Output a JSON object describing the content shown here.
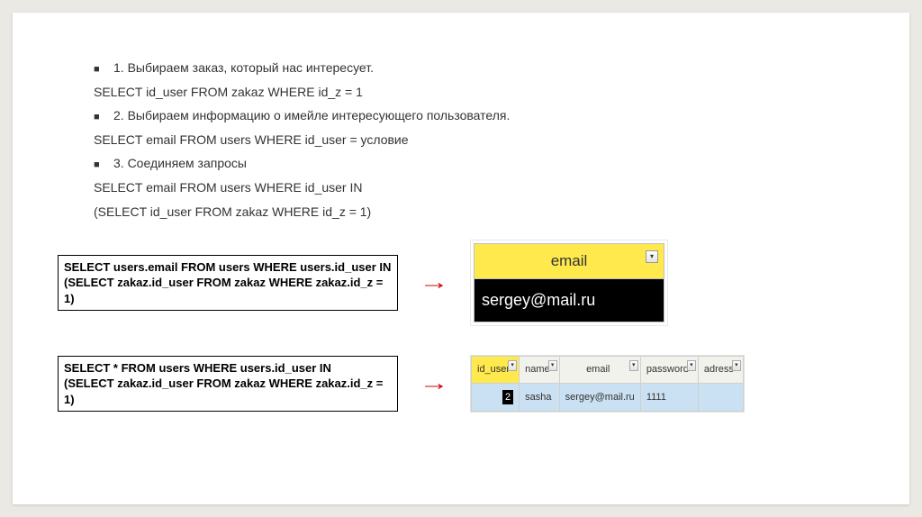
{
  "lines": {
    "b1": "1. Выбираем заказ, который нас интересует.",
    "c1": " SELECT id_user FROM zakaz WHERE id_z = 1",
    "b2": "2. Выбираем информацию о имейле интересующего пользователя.",
    "c2": "SELECT email FROM users WHERE id_user  = условие",
    "b3": "3. Соединяем запросы",
    "c3": "SELECT email FROM users WHERE id_user IN",
    "c4": "(SELECT id_user FROM zakaz WHERE id_z = 1)"
  },
  "query1": {
    "l1": "SELECT users.email FROM users WHERE users.id_user IN",
    "l2": "(SELECT zakaz.id_user FROM zakaz WHERE zakaz.id_z = 1)"
  },
  "query2": {
    "l1": "SELECT * FROM users WHERE users.id_user IN",
    "l2": "(SELECT zakaz.id_user FROM zakaz WHERE zakaz.id_z = 1)"
  },
  "result1": {
    "header": "email",
    "value": "sergey@mail.ru"
  },
  "result2": {
    "headers": [
      "id_user",
      "name",
      "email",
      "password",
      "adress"
    ],
    "row": {
      "id_user": "2",
      "name": "sasha",
      "email": "sergey@mail.ru",
      "password": "1111",
      "adress": ""
    }
  },
  "glyphs": {
    "bullet": "■",
    "arrow": "→",
    "dd": "▾"
  }
}
